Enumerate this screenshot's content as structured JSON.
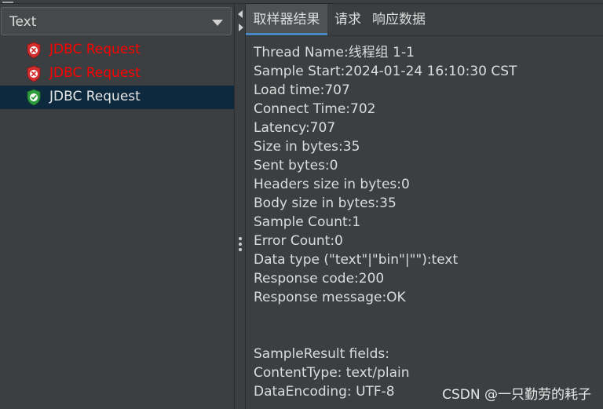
{
  "filter": {
    "selected": "Text"
  },
  "tree": {
    "items": [
      {
        "label": "JDBC Request",
        "status": "error",
        "icon": "error-shield-icon"
      },
      {
        "label": "JDBC Request",
        "status": "error",
        "icon": "error-shield-icon"
      },
      {
        "label": "JDBC Request",
        "status": "success",
        "icon": "success-shield-icon"
      }
    ]
  },
  "tabs": [
    {
      "label": "取样器结果",
      "active": true
    },
    {
      "label": "请求",
      "active": false
    },
    {
      "label": "响应数据",
      "active": false
    }
  ],
  "details": {
    "thread_name": "Thread Name:线程组 1-1",
    "sample_start": "Sample Start:2024-01-24 16:10:30 CST",
    "load_time": "Load time:707",
    "connect_time": "Connect Time:702",
    "latency": "Latency:707",
    "size_in_bytes": "Size in bytes:35",
    "sent_bytes": "Sent bytes:0",
    "headers_size": "Headers size in bytes:0",
    "body_size": "Body size in bytes:35",
    "sample_count": "Sample Count:1",
    "error_count": "Error Count:0",
    "data_type": "Data type (\"text\"|\"bin\"|\"\"):text",
    "response_code": "Response code:200",
    "response_message": "Response message:OK",
    "fields_header": "SampleResult fields:",
    "content_type": "ContentType: text/plain",
    "data_encoding": "DataEncoding: UTF-8"
  },
  "watermark": "CSDN @一只勤劳的耗子",
  "colors": {
    "background": "#3c3f41",
    "selected_row": "#0d293e",
    "error_text": "#ff0000",
    "tab_underline": "#4a88c7",
    "error_icon": "#d32f2f",
    "success_icon": "#2e9e3e"
  }
}
